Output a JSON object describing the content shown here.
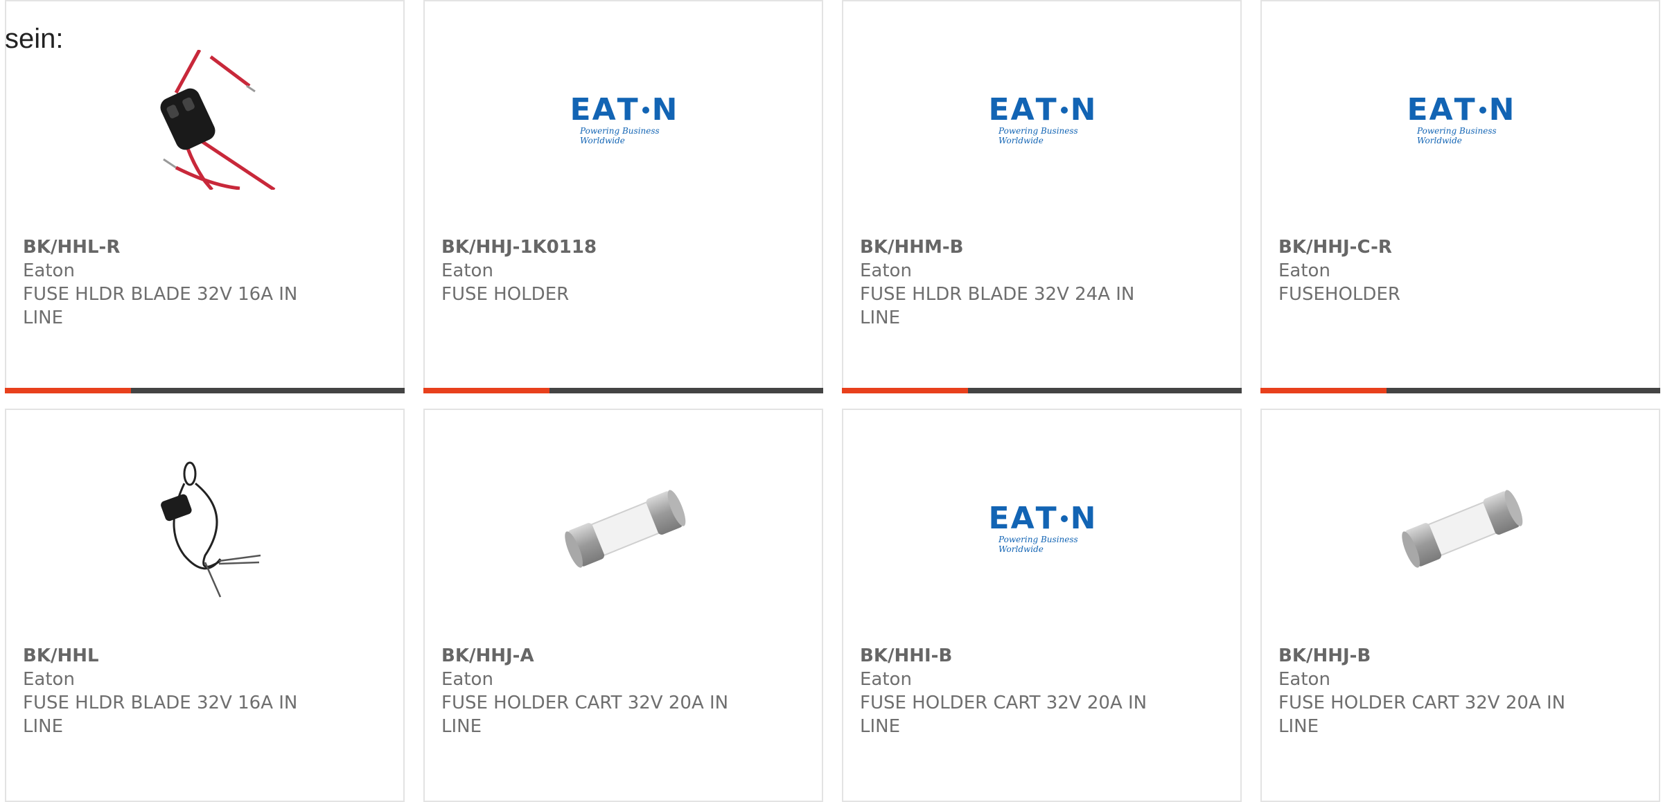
{
  "intro_text": "sein:",
  "colors": {
    "accent": "#e8401c",
    "bar": "#444444",
    "eaton_blue": "#1264b4",
    "text": "#6e6e6e"
  },
  "logo": {
    "wordmark": "EATON",
    "tagline": "Powering Business Worldwide"
  },
  "products": [
    {
      "part_number": "BK/HHL-R",
      "manufacturer": "Eaton",
      "description": "FUSE HLDR BLADE 32V 16A IN LINE",
      "image": "inline-blade-fuse-holder-red-wires"
    },
    {
      "part_number": "BK/HHJ-1K0118",
      "manufacturer": "Eaton",
      "description": "FUSE HOLDER",
      "image": "eaton-logo"
    },
    {
      "part_number": "BK/HHM-B",
      "manufacturer": "Eaton",
      "description": "FUSE HLDR BLADE 32V 24A IN LINE",
      "image": "eaton-logo"
    },
    {
      "part_number": "BK/HHJ-C-R",
      "manufacturer": "Eaton",
      "description": "FUSEHOLDER",
      "image": "eaton-logo"
    },
    {
      "part_number": "BK/HHL",
      "manufacturer": "Eaton",
      "description": "FUSE HLDR BLADE 32V 16A IN LINE",
      "image": "inline-blade-fuse-holder-black-wires"
    },
    {
      "part_number": "BK/HHJ-A",
      "manufacturer": "Eaton",
      "description": "FUSE HOLDER CART 32V 20A IN LINE",
      "image": "cartridge-fuse"
    },
    {
      "part_number": "BK/HHI-B",
      "manufacturer": "Eaton",
      "description": "FUSE HOLDER CART 32V 20A IN LINE",
      "image": "eaton-logo"
    },
    {
      "part_number": "BK/HHJ-B",
      "manufacturer": "Eaton",
      "description": "FUSE HOLDER CART 32V 20A IN LINE",
      "image": "cartridge-fuse"
    }
  ]
}
